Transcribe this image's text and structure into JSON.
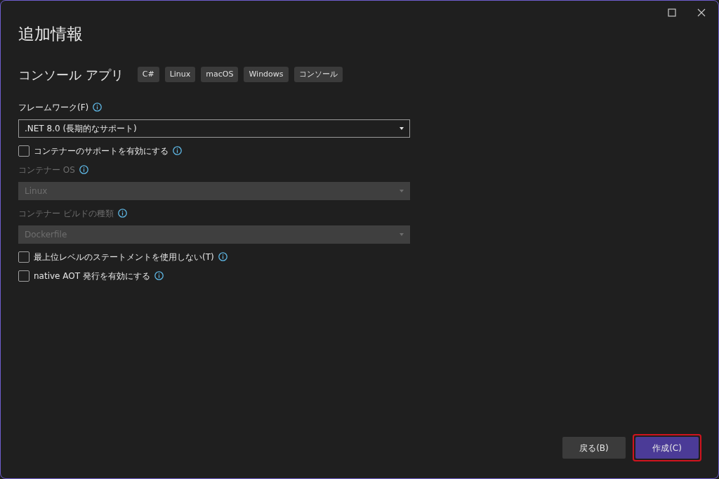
{
  "window": {
    "title": "追加情報"
  },
  "project": {
    "name": "コンソール アプリ",
    "tags": [
      "C#",
      "Linux",
      "macOS",
      "Windows",
      "コンソール"
    ]
  },
  "options": [
    {
      "kind": "label",
      "text": "フレームワーク(F)",
      "disabled": false
    },
    {
      "kind": "select",
      "value": ".NET 8.0 (長期的なサポート)",
      "disabled": false
    },
    {
      "kind": "checkbox",
      "text": "コンテナーのサポートを有効にする",
      "checked": false
    },
    {
      "kind": "label",
      "text": "コンテナー OS",
      "disabled": true
    },
    {
      "kind": "select",
      "value": "Linux",
      "disabled": true
    },
    {
      "kind": "label",
      "text": "コンテナー ビルドの種類",
      "disabled": true
    },
    {
      "kind": "select",
      "value": "Dockerfile",
      "disabled": true
    },
    {
      "kind": "checkbox",
      "text": "最上位レベルのステートメントを使用しない(T)",
      "checked": false
    },
    {
      "kind": "checkbox",
      "text": "native AOT 発行を有効にする",
      "checked": false
    }
  ],
  "buttons": [
    {
      "label": "戻る(B)",
      "primary": false,
      "highlighted": false
    },
    {
      "label": "作成(C)",
      "primary": true,
      "highlighted": true
    }
  ]
}
